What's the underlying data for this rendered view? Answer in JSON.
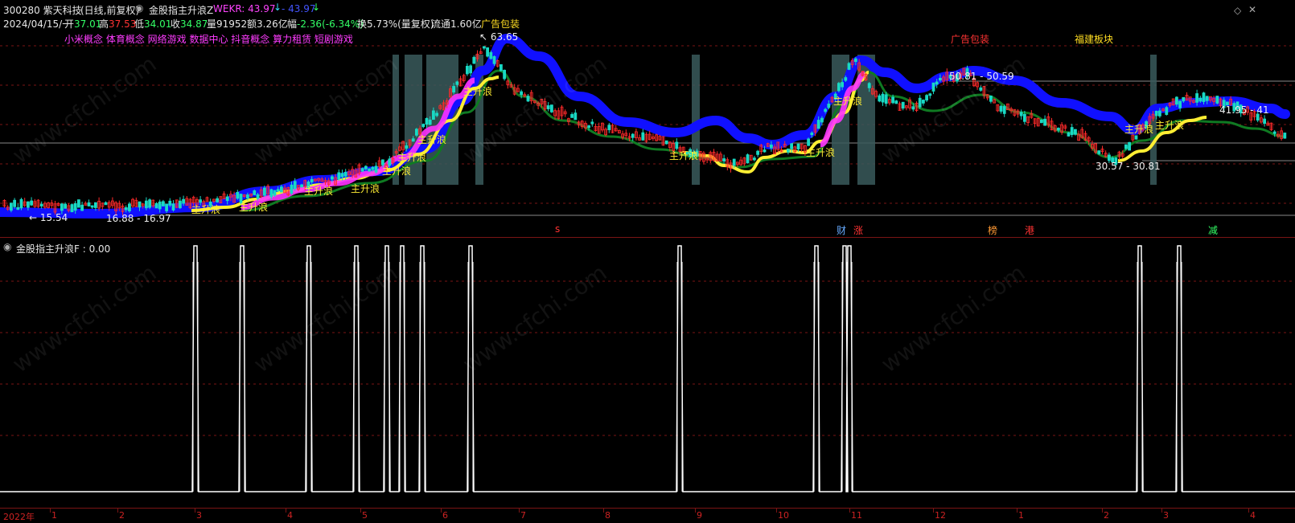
{
  "header": {
    "code_name": "300280 紫天科技",
    "period": "(日线,前复权)",
    "indicator_name": "金股指主升浪Z",
    "wekr_label": "WEKR: 43.97",
    "wekr_value2": "43.97",
    "date": "2024/04/15/一",
    "open_label": "开",
    "open_value": "37.01",
    "high_label": "高",
    "high_value": "37.53",
    "low_label": "低",
    "low_value": "34.01",
    "close_label": "收",
    "close_value": "34.87",
    "volume": "量91952",
    "amount": "额3.26亿",
    "change_label": "幅",
    "change_value": "-2.36(-6.34%)",
    "turnover": "换5.73%(量复权)",
    "float": "流通1.60亿",
    "sector": "广告包装"
  },
  "concepts": "小米概念 体育概念 网络游戏 数据中心 抖音概念 算力租赁 短剧游戏",
  "annotations": {
    "high_price": "63.65",
    "low_price_left": "15.54",
    "low_pair_left": "16.88 - 16.97",
    "mid_pair": "50.81 - 50.59",
    "right_pair": "41.95 - 41",
    "bottom_pair": "30.57 - 30.81",
    "sector_label_1": "广告包装",
    "sector_label_2": "福建板块",
    "wave_label": "主升浪"
  },
  "event_markers": [
    "s",
    "财",
    "涨",
    "榜",
    "港",
    "减"
  ],
  "sub_indicator": {
    "title": "金股指主升浪F : 0.00"
  },
  "time_axis": {
    "year_label": "2022年",
    "months": [
      "1",
      "2",
      "3",
      "4",
      "5",
      "6",
      "7",
      "8",
      "9",
      "10",
      "11",
      "12",
      "1",
      "2",
      "3",
      "4"
    ]
  },
  "watermark": "www.cfchi.com",
  "colors": {
    "up": "#ff2a2a",
    "down": "#19d9c4",
    "blue_band": "#1010ff",
    "yellow_line": "#ffee33",
    "green_line": "#0f7a22",
    "magenta_band": "#ff33ff",
    "signal_zone": "#3a5b5c",
    "grid": "#7a1414"
  },
  "icons": [
    "settings-circle-icon",
    "close-icon",
    "diamond-icon"
  ]
}
